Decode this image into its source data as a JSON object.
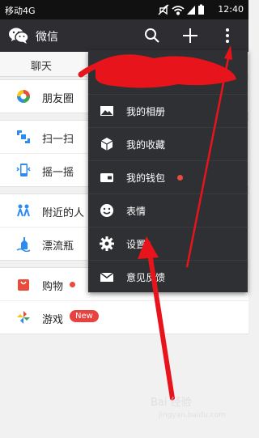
{
  "status_bar": {
    "carrier": "移动4G",
    "time": "12:40"
  },
  "app_bar": {
    "title": "微信",
    "icons": [
      "wechat-logo-icon",
      "search-icon",
      "plus-icon",
      "more-vertical-icon"
    ]
  },
  "tabs": [
    {
      "label": "聊天"
    }
  ],
  "discover": {
    "groups": [
      [
        {
          "label": "朋友圈",
          "icon": "moments-icon"
        }
      ],
      [
        {
          "label": "扫一扫",
          "icon": "scan-icon"
        },
        {
          "label": "摇一摇",
          "icon": "shake-icon"
        }
      ],
      [
        {
          "label": "附近的人",
          "icon": "nearby-icon"
        },
        {
          "label": "漂流瓶",
          "icon": "drift-bottle-icon"
        }
      ],
      [
        {
          "label": "购物",
          "icon": "shopping-icon"
        },
        {
          "label": "游戏",
          "icon": "game-icon",
          "badge": "New"
        }
      ]
    ]
  },
  "menu": {
    "items": [
      {
        "label": "我的相册",
        "icon": "photo-icon"
      },
      {
        "label": "我的收藏",
        "icon": "cube-icon"
      },
      {
        "label": "我的钱包",
        "icon": "wallet-icon"
      },
      {
        "label": "表情",
        "icon": "smiley-icon"
      },
      {
        "label": "设置",
        "icon": "gear-icon"
      },
      {
        "label": "意见反馈",
        "icon": "envelope-icon"
      }
    ]
  },
  "watermark": {
    "line1": "Bai 经验",
    "line2": "jingyan.baidu.com"
  },
  "colors": {
    "app_bar": "#2e2e32",
    "menu": "#2f3033",
    "badge": "#e64340",
    "annotation": "#e8141c"
  }
}
